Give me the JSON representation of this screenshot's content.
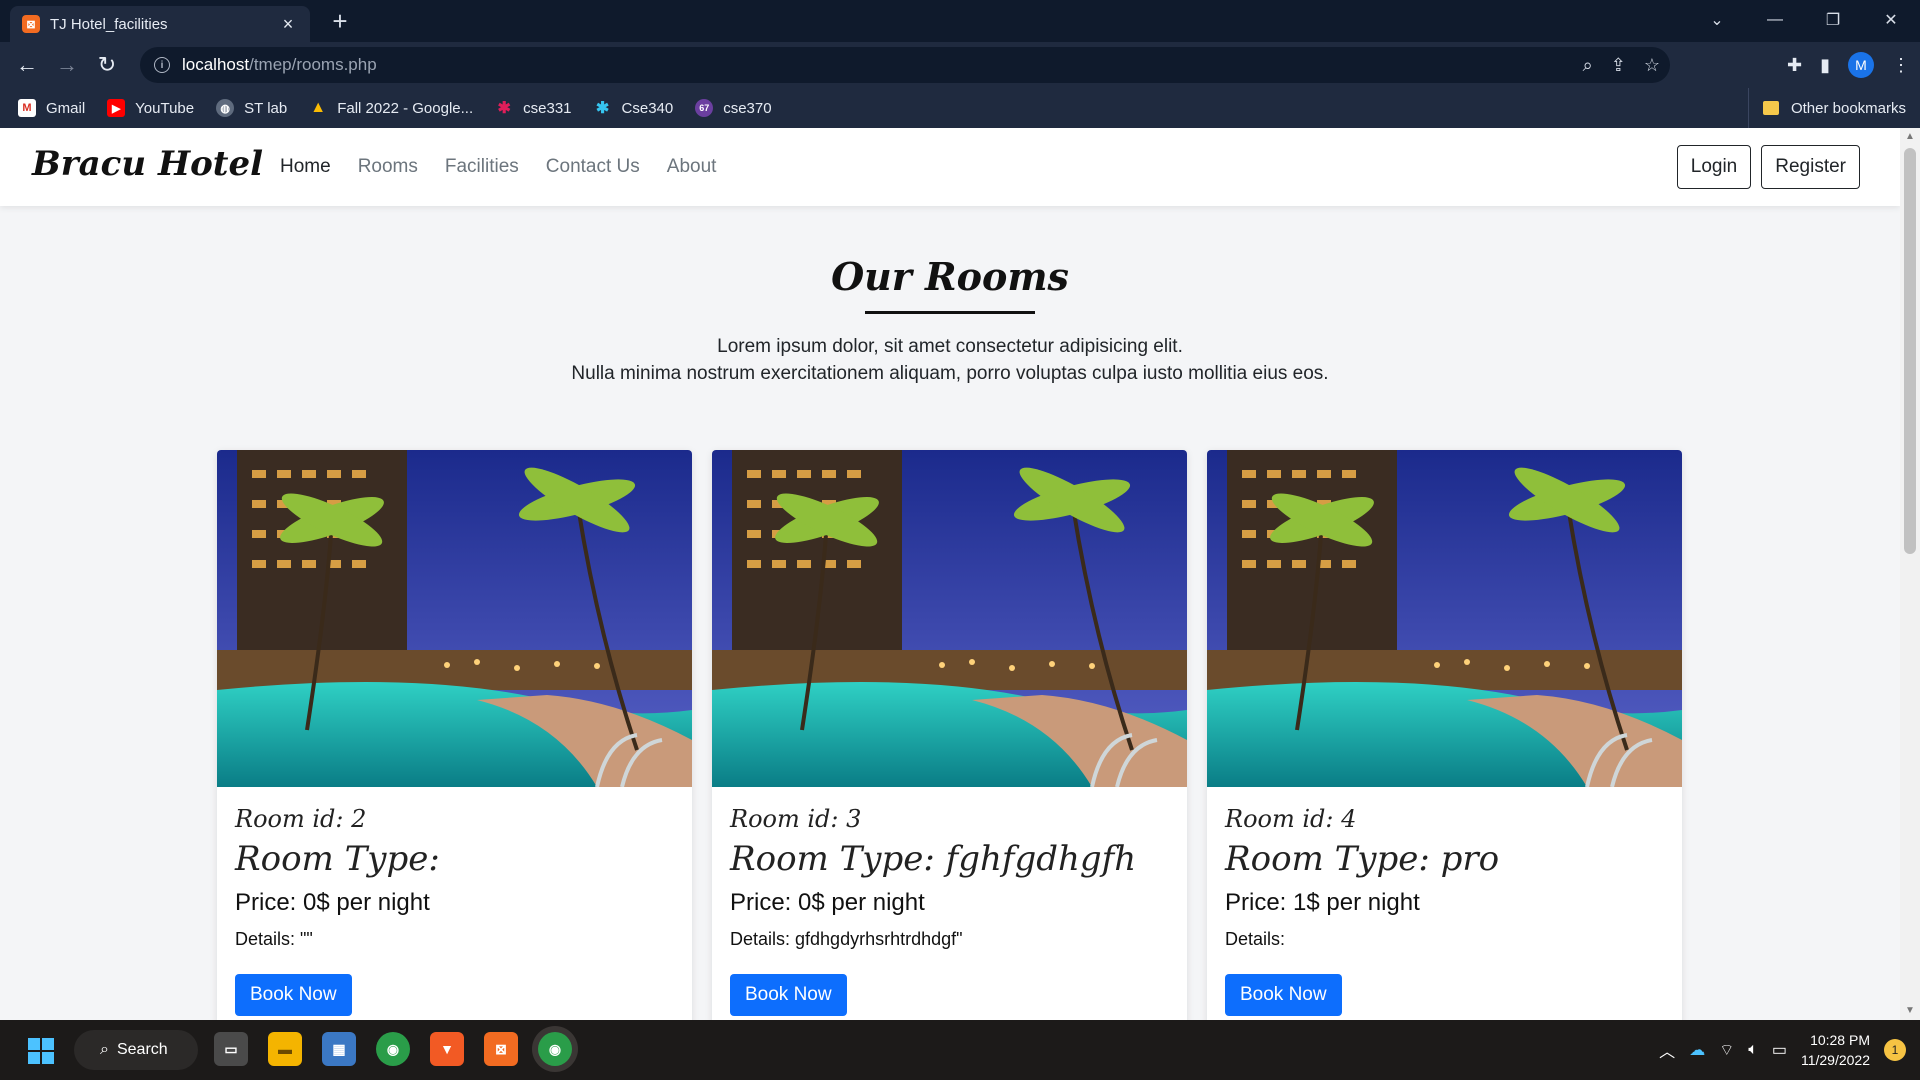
{
  "browser": {
    "tab_title": "TJ Hotel_facilities",
    "tab_favicon": "xampp-icon",
    "tab_close": "×",
    "new_tab": "+",
    "url_host": "localhost",
    "url_path": "/tmep/rooms.php",
    "profile_initial": "M",
    "bookmarks": [
      {
        "label": "Gmail",
        "icon": "gmail-icon"
      },
      {
        "label": "YouTube",
        "icon": "youtube-icon"
      },
      {
        "label": "ST lab",
        "icon": "globe-icon"
      },
      {
        "label": "Fall 2022 - Google...",
        "icon": "google-drive-icon"
      },
      {
        "label": "cse331",
        "icon": "slack-icon"
      },
      {
        "label": "Cse340",
        "icon": "slack-icon"
      },
      {
        "label": "cse370",
        "icon": "notification-badge-icon",
        "badge": "67"
      }
    ],
    "other_bookmarks": "Other bookmarks"
  },
  "site": {
    "brand": "Bracu Hotel",
    "nav": [
      "Home",
      "Rooms",
      "Facilities",
      "Contact Us",
      "About"
    ],
    "active_nav": "Home",
    "login": "Login",
    "register": "Register"
  },
  "main": {
    "title": "Our Rooms",
    "intro_line1": "Lorem ipsum dolor, sit amet consectetur adipisicing elit.",
    "intro_line2": "Nulla minima nostrum exercitationem aliquam, porro voluptas culpa iusto mollitia eius eos."
  },
  "rooms": [
    {
      "id_label": "Room id: 2",
      "type_label": "Room Type:",
      "price_label": "Price: 0$ per night",
      "details_label": "Details: \"\"",
      "button": "Book Now"
    },
    {
      "id_label": "Room id: 3",
      "type_label": "Room Type: fghfgdhgfh",
      "price_label": "Price: 0$ per night",
      "details_label": "Details: gfdhgdyrhsrhtrdhdgf\"",
      "button": "Book Now"
    },
    {
      "id_label": "Room id: 4",
      "type_label": "Room Type: pro",
      "price_label": "Price: 1$ per night",
      "details_label": "Details:",
      "button": "Book Now"
    }
  ],
  "taskbar": {
    "search_label": "Search",
    "time": "10:28 PM",
    "date": "11/29/2022",
    "notification_count": "1"
  },
  "colors": {
    "browser_dark": "#0f1a2c",
    "browser_toolbar": "#1f2a3f",
    "primary_button": "#0d6efd",
    "page_bg": "#f4f5f7"
  }
}
